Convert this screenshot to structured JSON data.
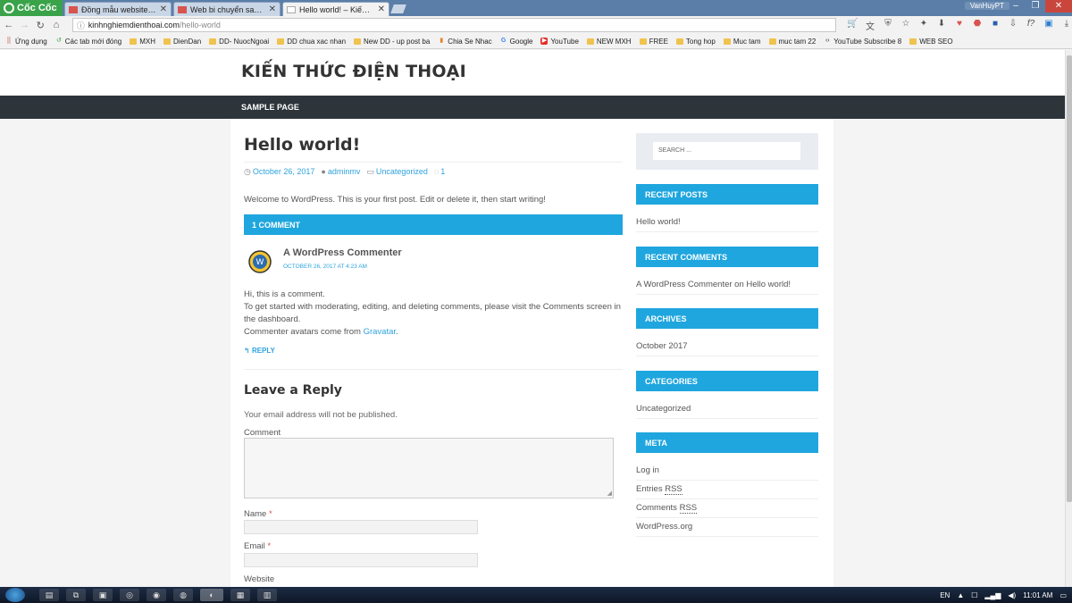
{
  "browser": {
    "brand": "Cốc Cốc",
    "user": "VanHuyPT",
    "tabs": [
      {
        "title": "Đồng mẫu website cho anh",
        "active": false
      },
      {
        "title": "Web bi chuyển sang https",
        "active": false
      },
      {
        "title": "Hello world! – Kiến thức đi",
        "active": true
      }
    ],
    "url_host": "kinhnghiemdienthoai.com",
    "url_path": "/hello-world",
    "bookmarks": [
      {
        "label": "Ứng dụng",
        "icon": "apps-grid-icon"
      },
      {
        "label": "Các tab mới đóng",
        "icon": "restore-icon"
      },
      {
        "label": "MXH",
        "icon": "folder-icon"
      },
      {
        "label": "DienDan",
        "icon": "folder-icon"
      },
      {
        "label": "DD- NuocNgoai",
        "icon": "folder-icon"
      },
      {
        "label": "DD chua xac nhan",
        "icon": "folder-icon"
      },
      {
        "label": "New DD - up post ba",
        "icon": "folder-icon"
      },
      {
        "label": "Chia Se Nhac",
        "icon": "chart-icon"
      },
      {
        "label": "Google",
        "icon": "google-icon"
      },
      {
        "label": "YouTube",
        "icon": "youtube-icon"
      },
      {
        "label": "NEW MXH",
        "icon": "folder-icon"
      },
      {
        "label": "FREE",
        "icon": "folder-icon"
      },
      {
        "label": "Tong hop",
        "icon": "folder-icon"
      },
      {
        "label": "Muc tam",
        "icon": "folder-icon"
      },
      {
        "label": "muc tam 22",
        "icon": "folder-icon"
      },
      {
        "label": "YouTube Subscribe 8",
        "icon": "code-icon"
      },
      {
        "label": "WEB SEO",
        "icon": "folder-icon"
      }
    ]
  },
  "site": {
    "title": "KIẾN THỨC ĐIỆN THOẠI",
    "menu_item": "SAMPLE PAGE"
  },
  "post": {
    "title": "Hello world!",
    "date": "October 26, 2017",
    "author": "adminmv",
    "category": "Uncategorized",
    "comment_count": "1",
    "intro": "Welcome to WordPress. This is your first post. Edit or delete it, then start writing!"
  },
  "comments": {
    "heading": "1 COMMENT",
    "author": "A WordPress Commenter",
    "date": "OCTOBER 26, 2017 AT 4:23 AM",
    "line1": "Hi, this is a comment.",
    "line2": "To get started with moderating, editing, and deleting comments, please visit the Comments screen in the dashboard.",
    "line3_prefix": "Commenter avatars come from ",
    "line3_link": "Gravatar",
    "line3_suffix": ".",
    "reply": "REPLY"
  },
  "reply_form": {
    "title": "Leave a Reply",
    "notice": "Your email address will not be published.",
    "comment_label": "Comment",
    "name_label": "Name",
    "email_label": "Email",
    "website_label": "Website",
    "required_mark": "*"
  },
  "sidebar": {
    "search_placeholder": "SEARCH ...",
    "recent_posts_title": "RECENT POSTS",
    "recent_post": "Hello world!",
    "recent_comments_title": "RECENT COMMENTS",
    "recent_comment_author": "A WordPress Commenter",
    "recent_comment_on": " on ",
    "recent_comment_post": "Hello world!",
    "archives_title": "ARCHIVES",
    "archive": "October 2017",
    "categories_title": "CATEGORIES",
    "category": "Uncategorized",
    "meta_title": "META",
    "meta_login": "Log in",
    "meta_entries": "Entries ",
    "meta_comments": "Comments ",
    "meta_rss": "RSS",
    "meta_wporg": "WordPress.org"
  },
  "taskbar": {
    "lang": "EN",
    "time": "11:01 AM"
  },
  "colors": {
    "accent": "#1fa6de",
    "menu_bg": "#2d353b",
    "link": "#2ea3dc"
  }
}
